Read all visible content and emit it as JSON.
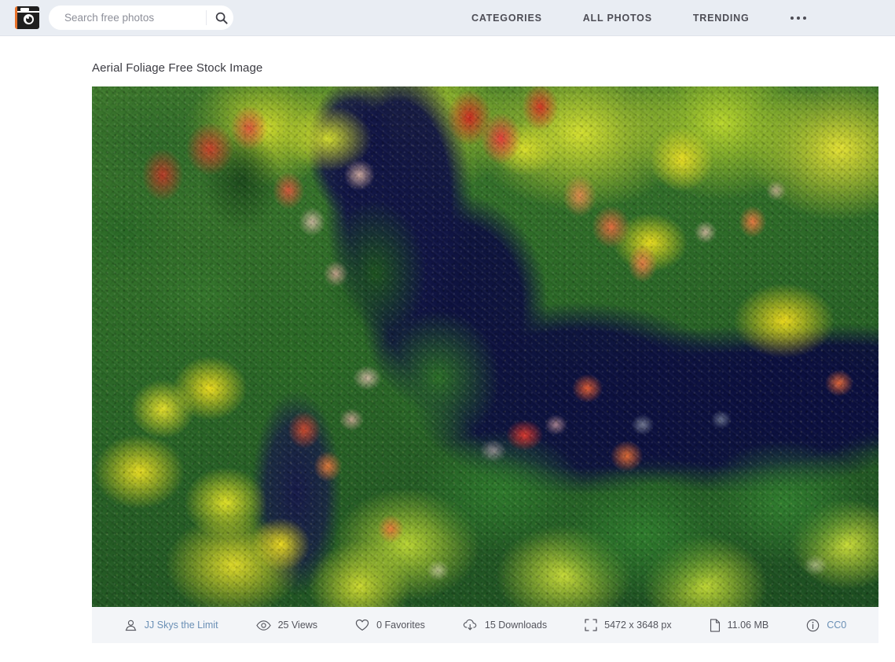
{
  "header": {
    "logo_icon": "camera-icon",
    "logo_accent_color": "#e8722a",
    "background_color": "#e9edf3",
    "search": {
      "placeholder": "Search free photos",
      "value": "",
      "icon": "search-icon"
    },
    "nav": {
      "items": [
        {
          "label": "CATEGORIES",
          "name": "categories"
        },
        {
          "label": "ALL PHOTOS",
          "name": "all-photos"
        },
        {
          "label": "TRENDING",
          "name": "trending"
        }
      ],
      "more_icon": "ellipsis-icon"
    }
  },
  "main": {
    "title": "Aerial Foliage Free Stock Image",
    "photo": {
      "alt": "Aerial Foliage Free Stock Image",
      "subject": "aerial view of autumn forest foliage with dark navy river"
    }
  },
  "meta": {
    "items": [
      {
        "icon": "user-icon",
        "label": "JJ Skys the Limit",
        "is_link": true,
        "name": "author"
      },
      {
        "icon": "eye-icon",
        "label": "25 Views",
        "is_link": false,
        "name": "views"
      },
      {
        "icon": "heart-icon",
        "label": "0 Favorites",
        "is_link": false,
        "name": "favorites"
      },
      {
        "icon": "cloud-download-icon",
        "label": "15 Downloads",
        "is_link": false,
        "name": "downloads"
      },
      {
        "icon": "dimensions-icon",
        "label": "5472 x 3648 px",
        "is_link": false,
        "name": "dimensions"
      },
      {
        "icon": "file-icon",
        "label": "11.06 MB",
        "is_link": false,
        "name": "filesize"
      },
      {
        "icon": "info-icon",
        "label": "CC0",
        "is_link": true,
        "name": "license"
      }
    ],
    "background_color": "#f3f5f8",
    "link_color": "#6a8fb5"
  }
}
